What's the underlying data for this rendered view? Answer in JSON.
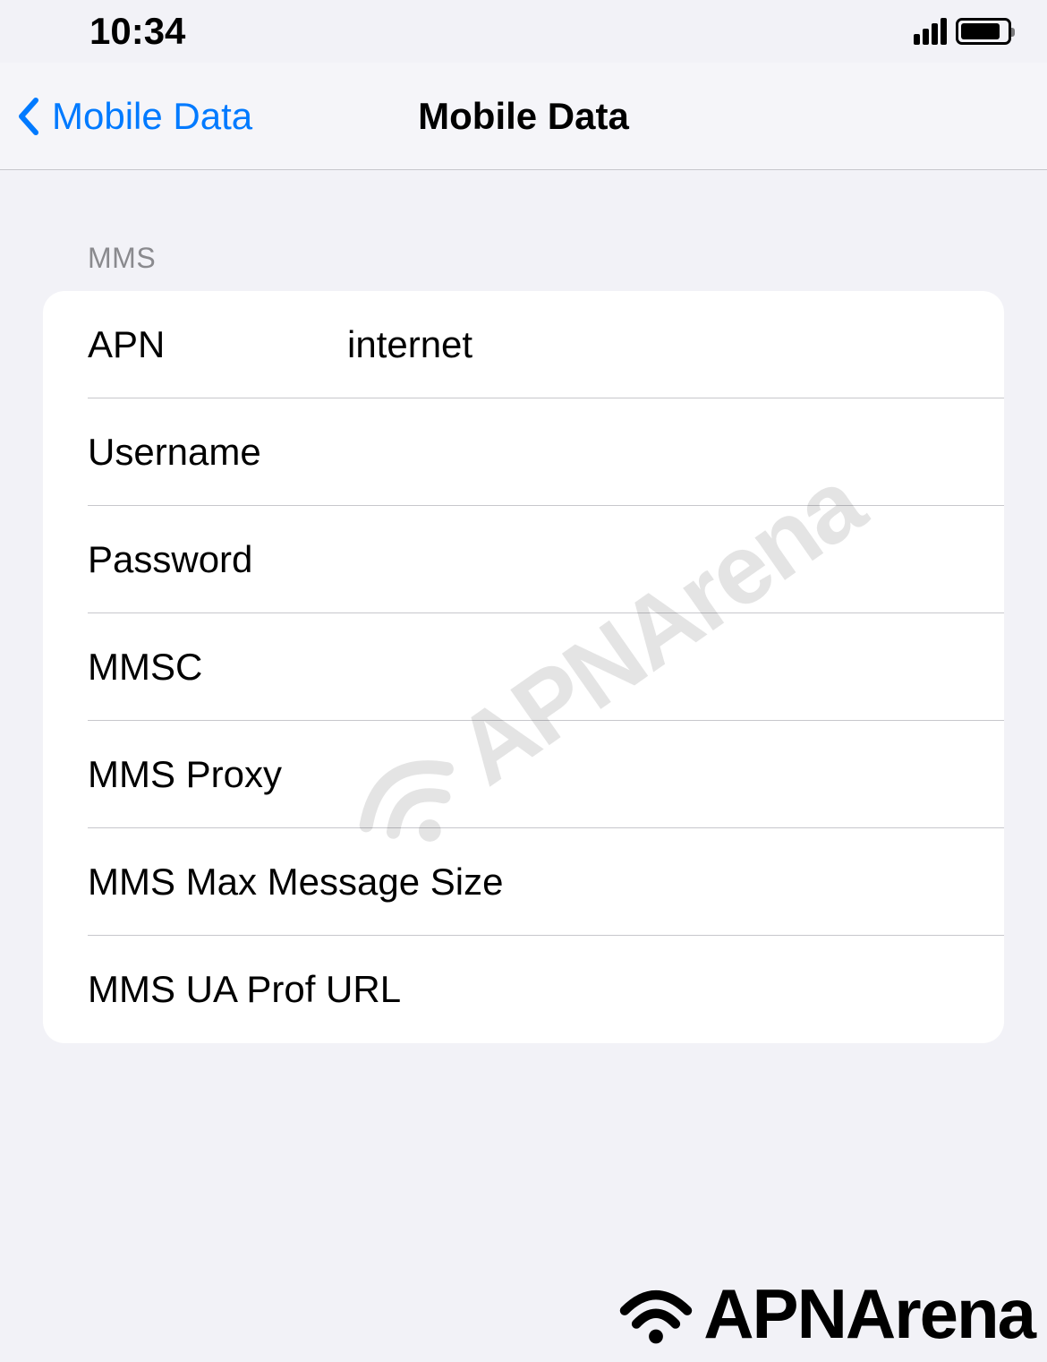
{
  "status": {
    "time": "10:34"
  },
  "nav": {
    "back_label": "Mobile Data",
    "title": "Mobile Data"
  },
  "section": {
    "header": "MMS",
    "rows": {
      "apn": {
        "label": "APN",
        "value": "internet"
      },
      "username": {
        "label": "Username",
        "value": ""
      },
      "password": {
        "label": "Password",
        "value": ""
      },
      "mmsc": {
        "label": "MMSC",
        "value": ""
      },
      "mms_proxy": {
        "label": "MMS Proxy",
        "value": ""
      },
      "mms_max": {
        "label": "MMS Max Message Size",
        "value": ""
      },
      "mms_ua": {
        "label": "MMS UA Prof URL",
        "value": ""
      }
    }
  },
  "branding": {
    "watermark": "APNArena",
    "logo": "APNArena"
  }
}
